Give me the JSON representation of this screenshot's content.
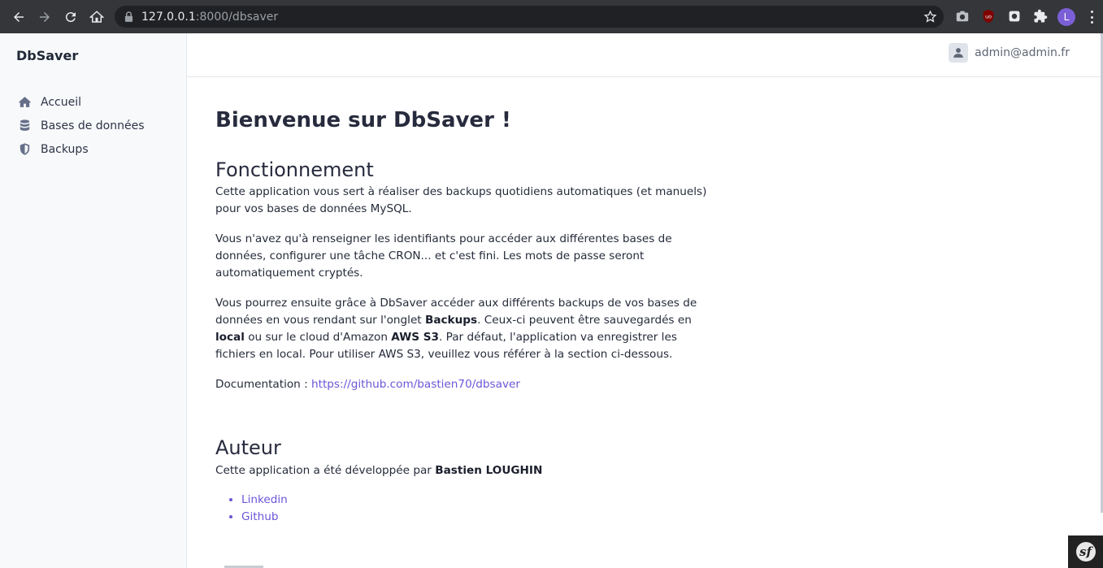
{
  "browser": {
    "url_host": "127.0.0.1",
    "url_path": ":8000/dbsaver",
    "profile_initial": "L"
  },
  "sidebar": {
    "brand": "DbSaver",
    "items": [
      {
        "label": "Accueil",
        "icon": "home-icon"
      },
      {
        "label": "Bases de données",
        "icon": "database-icon"
      },
      {
        "label": "Backups",
        "icon": "shield-icon"
      }
    ]
  },
  "header": {
    "user_email": "admin@admin.fr"
  },
  "main": {
    "title": "Bienvenue sur DbSaver !",
    "section1": {
      "title": "Fonctionnement",
      "p1": "Cette application vous sert à réaliser des backups quotidiens automatiques (et manuels) pour vos bases de données MySQL.",
      "p2": "Vous n'avez qu'à renseigner les identifiants pour accéder aux différentes bases de données, configurer une tâche CRON... et c'est fini. Les mots de passe seront automatiquement cryptés.",
      "p3_a": "Vous pourrez ensuite grâce à DbSaver accéder aux différents backups de vos bases de données en vous rendant sur l'onglet ",
      "p3_b": "Backups",
      "p3_c": ". Ceux-ci peuvent être sauvegardés en ",
      "p3_d": "local",
      "p3_e": " ou sur le cloud d'Amazon ",
      "p3_f": "AWS S3",
      "p3_g": ". Par défaut, l'application va enregistrer les fichiers en local. Pour utiliser AWS S3, veuillez vous référer à la section ci-dessous.",
      "doc_label": "Documentation : ",
      "doc_link": "https://github.com/bastien70/dbsaver"
    },
    "section2": {
      "title": "Auteur",
      "text": "Cette application a été développée par ",
      "author": "Bastien LOUGHIN",
      "links": [
        "Linkedin",
        "Github"
      ]
    }
  },
  "colors": {
    "link": "#6b56d8",
    "sidebar_bg": "#f8f9fb",
    "chrome_bg": "#35363a"
  }
}
